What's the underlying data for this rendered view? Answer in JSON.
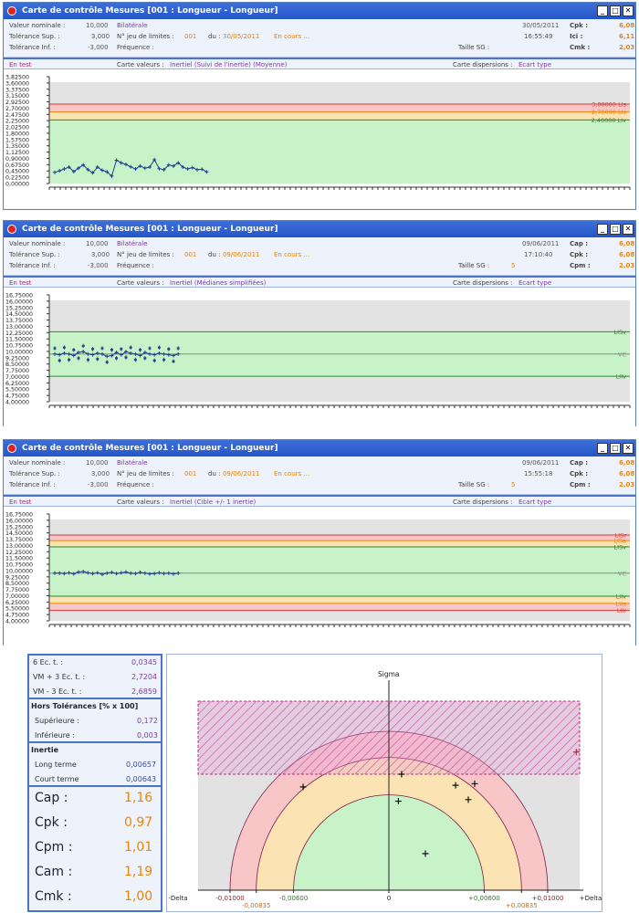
{
  "windows": [
    {
      "title": "Carte de contrôle Mesures [001 : Longueur - Longueur]",
      "nominal_label": "Valeur nominale :",
      "nominal": "10,000",
      "tol_sup_label": "Tolérance Sup. :",
      "tol_sup": "3,000",
      "tol_inf_label": "Tolérance Inf. :",
      "tol_inf": "-3,000",
      "type": "Bilatérale",
      "jeu_label": "N° jeu de limites :",
      "jeu": "001",
      "du_label": "du :",
      "du": "30/05/2011",
      "status": "En cours ...",
      "freq_label": "Fréquence :",
      "taille_label": "Taille SG :",
      "taille": "",
      "date": "30/05/2011",
      "time": "16:55:49",
      "i1_label": "Cpk :",
      "i1": "6,08",
      "i2_label": "Ici :",
      "i2": "6,11",
      "i3_label": "Cmk :",
      "i3": "2,03",
      "en_test": "En test",
      "carte_label": "Carte valeurs :",
      "carte": "Inertiel (Suivi de l'inertie) (Moyenne)",
      "disp_label": "Carte dispersions :",
      "disp": "Ecart type",
      "yticks": [
        "3,82500",
        "3,60000",
        "3,37500",
        "3,15000",
        "2,92500",
        "2,70000",
        "2,47500",
        "2,25000",
        "2,02500",
        "1,80000",
        "1,57500",
        "1,35000",
        "1,12500",
        "0,90000",
        "0,67500",
        "0,45000",
        "0,22500",
        "0,00000"
      ],
      "limit_labels": [
        {
          "value": "3,00000",
          "label": "LIs",
          "color": "#d23b3b"
        },
        {
          "value": "2,70000",
          "label": "LIs",
          "color": "#e8850c"
        },
        {
          "value": "2,40000",
          "label": "LIv",
          "color": "#2c8a2c"
        }
      ]
    },
    {
      "title": "Carte de contrôle Mesures [001 : Longueur - Longueur]",
      "nominal_label": "Valeur nominale :",
      "nominal": "10,000",
      "tol_sup_label": "Tolérance Sup. :",
      "tol_sup": "3,000",
      "tol_inf_label": "Tolérance Inf. :",
      "tol_inf": "-3,000",
      "type": "Bilatérale",
      "jeu_label": "N° jeu de limites :",
      "jeu": "001",
      "du_label": "du :",
      "du": "09/06/2011",
      "status": "En cours ...",
      "freq_label": "Fréquence :",
      "taille_label": "Taille SG :",
      "taille": "5",
      "date": "09/06/2011",
      "time": "17:10:40",
      "i1_label": "Cap :",
      "i1": "6,08",
      "i2_label": "Cpk :",
      "i2": "6,08",
      "i3_label": "Cpm :",
      "i3": "2,03",
      "en_test": "En test",
      "carte_label": "Carte valeurs :",
      "carte": "Inertiel (Médianes simplifiées)",
      "disp_label": "Carte dispersions :",
      "disp": "Ecart type",
      "yticks": [
        "16,75000",
        "16,00000",
        "15,25000",
        "14,50000",
        "13,75000",
        "13,00000",
        "12,25000",
        "11,50000",
        "10,75000",
        "10,00000",
        "9,25000",
        "8,50000",
        "7,75000",
        "7,00000",
        "6,25000",
        "5,50000",
        "4,75000",
        "4,00000"
      ],
      "limit_labels": [
        {
          "value": "",
          "label": "LISv",
          "color": "#2c8a2c"
        },
        {
          "value": "",
          "label": "VC",
          "color": "#888888"
        },
        {
          "value": "",
          "label": "LIIv",
          "color": "#2c8a2c"
        }
      ]
    },
    {
      "title": "Carte de contrôle Mesures [001 : Longueur - Longueur]",
      "nominal_label": "Valeur nominale :",
      "nominal": "10,000",
      "tol_sup_label": "Tolérance Sup. :",
      "tol_sup": "3,000",
      "tol_inf_label": "Tolérance Inf. :",
      "tol_inf": "-3,000",
      "type": "Bilatérale",
      "jeu_label": "N° jeu de limites :",
      "jeu": "001",
      "du_label": "du :",
      "du": "09/06/2011",
      "status": "En cours ...",
      "freq_label": "Fréquence :",
      "taille_label": "Taille SG :",
      "taille": "5",
      "date": "09/06/2011",
      "time": "15:55:18",
      "i1_label": "Cap :",
      "i1": "6,08",
      "i2_label": "Cpk :",
      "i2": "6,08",
      "i3_label": "Cpm :",
      "i3": "2,03",
      "en_test": "En test",
      "carte_label": "Carte valeurs :",
      "carte": "Inertiel (Cible +/- 1 inertie)",
      "disp_label": "Carte dispersions :",
      "disp": "Ecart type",
      "yticks": [
        "16,75000",
        "16,00000",
        "15,25000",
        "14,50000",
        "13,75000",
        "13,00000",
        "12,25000",
        "11,50000",
        "10,75000",
        "10,00000",
        "9,25000",
        "8,50000",
        "7,75000",
        "7,00000",
        "6,25000",
        "5,50000",
        "4,75000",
        "4,00000"
      ],
      "limit_labels": [
        {
          "value": "",
          "label": "LISr",
          "color": "#d23b3b"
        },
        {
          "value": "",
          "label": "LISa",
          "color": "#e8850c"
        },
        {
          "value": "",
          "label": "LISv",
          "color": "#2c8a2c"
        },
        {
          "value": "",
          "label": "VC",
          "color": "#888888"
        },
        {
          "value": "",
          "label": "LIIv",
          "color": "#2c8a2c"
        },
        {
          "value": "",
          "label": "LIIa",
          "color": "#e8850c"
        },
        {
          "value": "",
          "label": "LIIr",
          "color": "#d23b3b"
        }
      ]
    }
  ],
  "panel": {
    "ect_label": "6 Ec. t. :",
    "ect": "0,0345",
    "vmp_label": "VM + 3 Ec. t. :",
    "vmp": "2,7204",
    "vmm_label": "VM - 3 Ec. t. :",
    "vmm": "2,6859",
    "hors_title": "Hors Tolérances [% x 100]",
    "sup_label": "Supérieure :",
    "sup": "0,172",
    "inf_label": "Inférieure :",
    "inf": "0,003",
    "inertie_title": "Inertie",
    "long_label": "Long terme",
    "long": "0,00657",
    "court_label": "Court terme",
    "court": "0,00643",
    "indices": [
      {
        "label": "Cap :",
        "value": "1,16"
      },
      {
        "label": "Cpk :",
        "value": "0,97"
      },
      {
        "label": "Cpm :",
        "value": "1,01"
      },
      {
        "label": "Cam :",
        "value": "1,19"
      },
      {
        "label": "Cmk :",
        "value": "1,00"
      }
    ]
  },
  "chart_data": [
    {
      "type": "line",
      "title": "",
      "ylim": [
        0,
        3.825
      ],
      "limits": [
        3.0,
        2.7,
        2.4
      ],
      "values": [
        0.42,
        0.48,
        0.55,
        0.62,
        0.45,
        0.58,
        0.7,
        0.52,
        0.4,
        0.62,
        0.5,
        0.44,
        0.28,
        0.88,
        0.78,
        0.72,
        0.63,
        0.55,
        0.66,
        0.58,
        0.62,
        0.9,
        0.56,
        0.52,
        0.7,
        0.66,
        0.78,
        0.62,
        0.55,
        0.6,
        0.52,
        0.54,
        0.44
      ]
    },
    {
      "type": "line",
      "title": "",
      "ylim": [
        4.0,
        16.75
      ],
      "limits": [
        12.8,
        10.0,
        7.2
      ],
      "values": [
        10.0,
        9.9,
        10.1,
        10.0,
        9.8,
        10.2,
        10.3,
        10.0,
        9.9,
        10.1,
        10.0,
        9.7,
        9.8,
        10.2,
        9.9,
        10.3,
        10.1,
        10.0,
        9.8,
        10.2,
        10.0,
        9.9,
        10.1,
        10.0,
        9.9,
        9.8,
        10.0
      ],
      "scatter_offsets": [
        0.9,
        -0.8,
        0.7,
        -0.9,
        0.8,
        -0.7
      ]
    },
    {
      "type": "line",
      "title": "",
      "ylim": [
        4.0,
        16.75
      ],
      "limits": [
        14.8,
        14.1,
        13.3,
        10.0,
        7.1,
        6.2,
        5.3
      ],
      "values": [
        10.0,
        10.0,
        9.95,
        10.05,
        9.9,
        10.15,
        10.2,
        10.05,
        9.95,
        10.05,
        9.85,
        10.0,
        10.1,
        9.95,
        10.05,
        10.15,
        10.0,
        9.95,
        10.1,
        10.0,
        9.9,
        9.95,
        10.05,
        9.95,
        10.0,
        9.9,
        10.0
      ]
    },
    {
      "type": "scatter",
      "title": "",
      "ylabel": "Sigma",
      "x_axis_labels": [
        "-Delta",
        "-0,01000",
        "-0,00835",
        "-0,00600",
        "0",
        "+0,00600",
        "+0,00835",
        "+0,01000",
        "+Delta"
      ],
      "x_tick_values": [
        -0.012,
        -0.01,
        -0.00835,
        -0.006,
        0,
        0.006,
        0.00835,
        0.01,
        0.012
      ],
      "xlim": [
        -0.012,
        0.012
      ],
      "ylim": [
        0,
        0.0119
      ],
      "semicircle_radii": [
        0.01,
        0.00835,
        0.006
      ],
      "hatched_band": [
        0.0073,
        0.0119
      ],
      "points": [
        {
          "x": -0.0054,
          "y": 0.0065
        },
        {
          "x": 0.0008,
          "y": 0.0073
        },
        {
          "x": 0.0006,
          "y": 0.0056
        },
        {
          "x": 0.0042,
          "y": 0.0066
        },
        {
          "x": 0.0054,
          "y": 0.0067
        },
        {
          "x": 0.005,
          "y": 0.0057
        },
        {
          "x": 0.0023,
          "y": 0.0023
        },
        {
          "x": 0.0118,
          "y": 0.0087
        }
      ]
    }
  ]
}
